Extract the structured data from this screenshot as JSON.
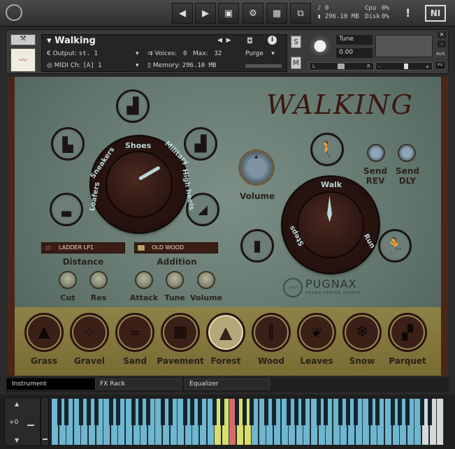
{
  "topbar": {
    "voices_count": "0",
    "memory": "296.10 MB",
    "cpu_label": "Cpu",
    "cpu_value": "0%",
    "disk_label": "Disk",
    "disk_value": "0%",
    "warning": "!",
    "ni_logo": "NI"
  },
  "header": {
    "instrument_name": "Walking",
    "output_label": "Output:",
    "output_value": "st. 1",
    "voices_label": "Voices:",
    "voices_value": "0",
    "max_label": "Max:",
    "max_value": "32",
    "purge_label": "Purge",
    "midi_label": "MIDI Ch:",
    "midi_value": "[A]  1",
    "memory_label": "Memory:",
    "memory_value": "296.10 MB",
    "solo": "S",
    "mute": "M",
    "tune_label": "Tune",
    "tune_value": "0.00",
    "pan_left": "L",
    "pan_right": "R",
    "vol_minus": "-",
    "vol_plus": "+",
    "aux": "AUX",
    "pv": "PV",
    "close": "×",
    "minimize": "-",
    "info": "i"
  },
  "instrument": {
    "title": "WALKING",
    "shoe_dial": {
      "labels": [
        "Shoes",
        "Military",
        "High heels",
        "Loafers",
        "Sneakers"
      ]
    },
    "walk_dial": {
      "labels": [
        "Walk",
        "Run",
        "Steps"
      ]
    },
    "volume_label": "Volume",
    "send_rev_label": "Send\nREV",
    "send_rev_l1": "Send",
    "send_rev_l2": "REV",
    "send_dly_l1": "Send",
    "send_dly_l2": "DLY",
    "filter_select": "LADDER LP1",
    "addition_select": "OLD WOOD",
    "distance_label": "Distance",
    "addition_label": "Addition",
    "knobs": [
      "Cut",
      "Res",
      "Attack",
      "Tune",
      "Volume"
    ],
    "brand": "PUGNAX",
    "brand_sub": "SOUND DESIGN STUDIO",
    "materials": [
      "Grass",
      "Gravel",
      "Sand",
      "Pavement",
      "Forest",
      "Wood",
      "Leaves",
      "Snow",
      "Parquet"
    ],
    "selected_material": "Forest"
  },
  "tabs": [
    "Instrument",
    "FX Rack",
    "Equalizer"
  ],
  "keyboard": {
    "octave": "+0"
  },
  "colors": {
    "panel": "#5e7267",
    "wood": "#4a2618",
    "strip": "#8d8248",
    "key_blue": "#6fb6cf",
    "key_highlight_yellow": "#d7df6a",
    "key_highlight_red": "#d86a6a"
  }
}
